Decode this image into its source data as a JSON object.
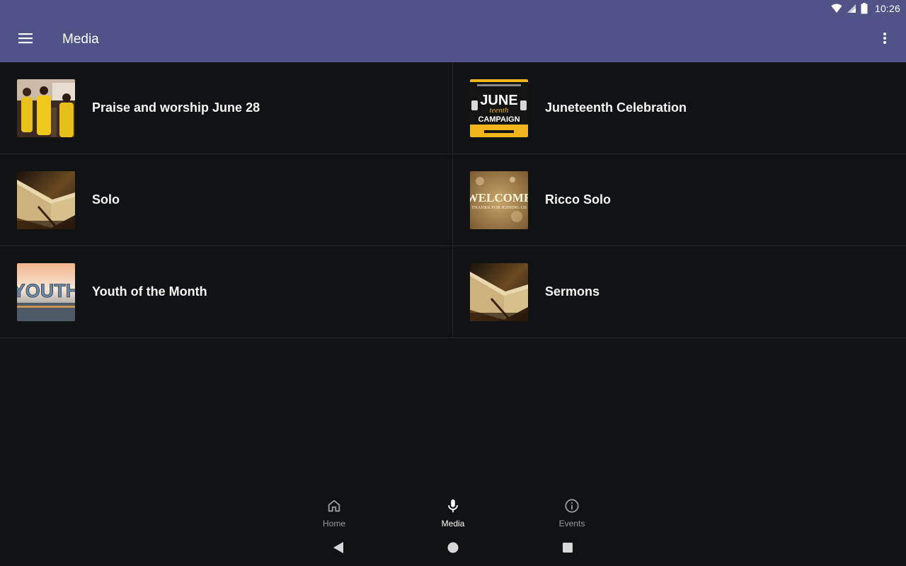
{
  "status_bar": {
    "time": "10:26",
    "icons": [
      "wifi-icon",
      "cell-signal-icon",
      "battery-icon"
    ]
  },
  "app_bar": {
    "title": "Media",
    "menu_icon": "hamburger-menu-icon",
    "overflow_icon": "more-vert-icon",
    "color": "#505387"
  },
  "media": {
    "items": [
      {
        "label": "Praise and worship June 28",
        "thumbnail": "choir-photo"
      },
      {
        "label": "Juneteenth Celebration",
        "thumbnail": "juneteenth-flyer",
        "flyer_lines": [
          "JUNE",
          "teenth",
          "CAMPAIGN"
        ]
      },
      {
        "label": "Solo",
        "thumbnail": "open-bible"
      },
      {
        "label": "Ricco Solo",
        "thumbnail": "welcome-card",
        "card_lines": [
          "WELCOME",
          "THANKS FOR JOINING US"
        ]
      },
      {
        "label": "Youth of the Month",
        "thumbnail": "youth-banner",
        "banner_text": "YOUTH"
      },
      {
        "label": "Sermons",
        "thumbnail": "open-bible"
      }
    ]
  },
  "bottom_nav": {
    "items": [
      {
        "label": "Home",
        "icon": "home-icon",
        "active": false
      },
      {
        "label": "Media",
        "icon": "microphone-icon",
        "active": true
      },
      {
        "label": "Events",
        "icon": "info-icon",
        "active": false
      }
    ]
  },
  "system_nav": {
    "icons": [
      "back-icon",
      "home-circle-icon",
      "recents-icon"
    ]
  },
  "colors": {
    "background": "#111214",
    "divider": "#25262a",
    "nav_inactive": "#9a9aa0",
    "nav_active": "#ffffff"
  }
}
